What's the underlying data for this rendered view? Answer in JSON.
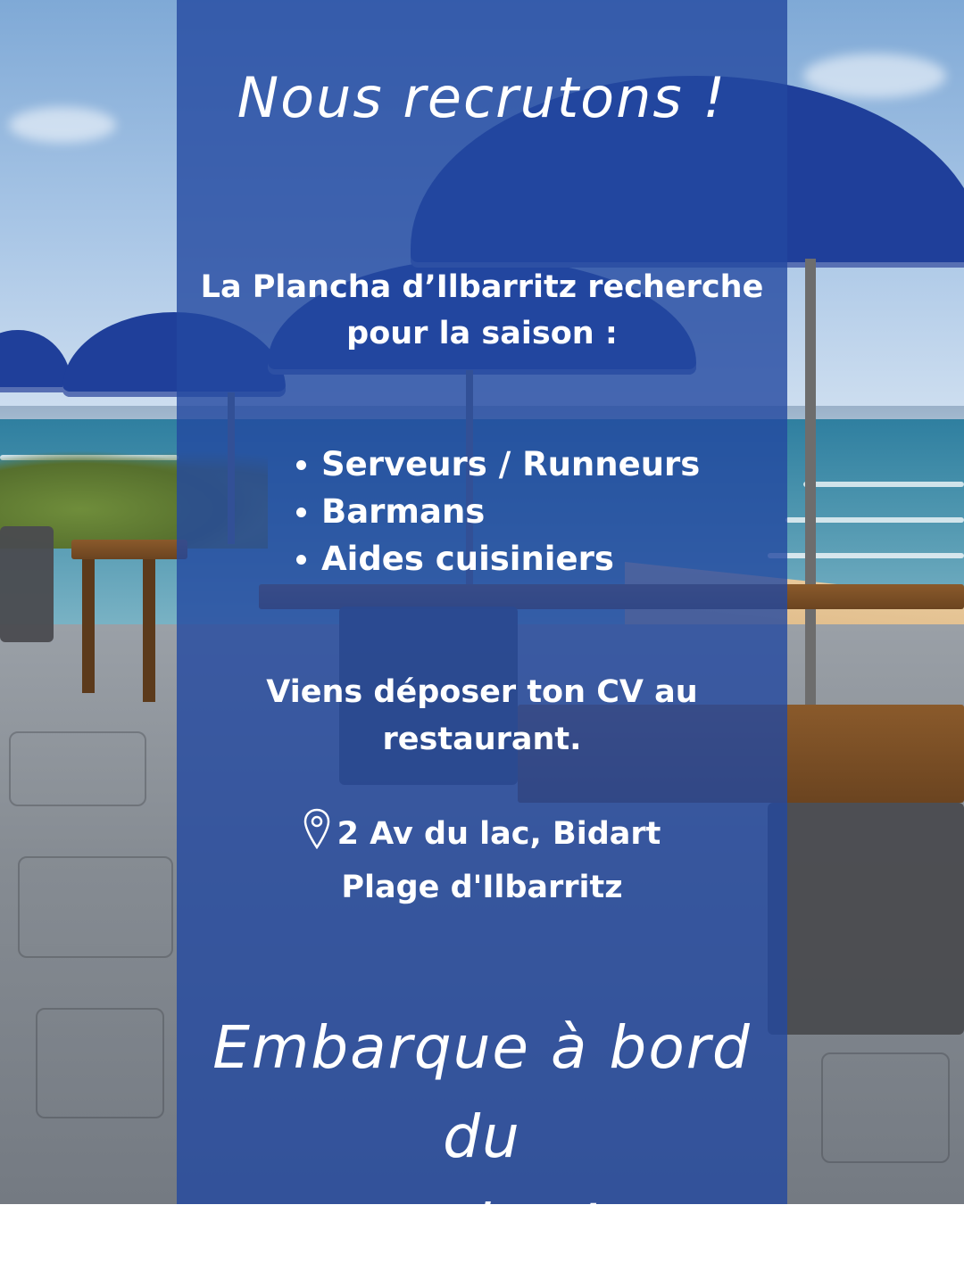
{
  "poster": {
    "headline": "Nous recrutons !",
    "intro_line1": "La Plancha d’Ilbarritz recherche",
    "intro_line2": "pour la saison :",
    "positions": [
      "Serveurs / Runneurs",
      "Barmans",
      "Aides cuisiniers"
    ],
    "cv_line1": "Viens déposer ton CV au",
    "cv_line2": "restaurant.",
    "address_line1": "2 Av du lac, Bidart",
    "address_line2": "Plage d'Ilbarritz",
    "cta_line1": "Embarque à bord du",
    "cta_line2": "navire !"
  },
  "icons": {
    "location": "location-pin-icon"
  },
  "colors": {
    "panel": "#2348a0",
    "text": "#ffffff",
    "umbrella": "#1f3f9a"
  }
}
